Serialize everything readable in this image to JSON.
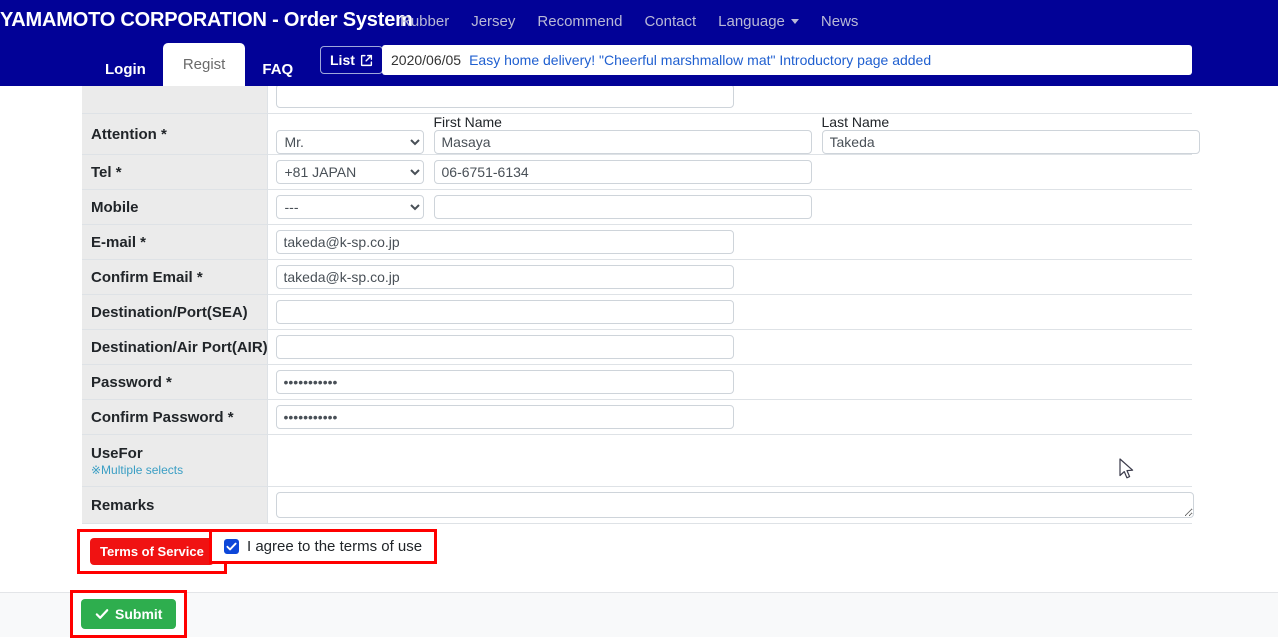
{
  "navbar": {
    "brand": "YAMAMOTO CORPORATION - Order System",
    "links": [
      {
        "label": "Rubber",
        "dropdown": false
      },
      {
        "label": "Jersey",
        "dropdown": false
      },
      {
        "label": "Recommend",
        "dropdown": false
      },
      {
        "label": "Contact",
        "dropdown": false
      },
      {
        "label": "Language",
        "dropdown": true
      },
      {
        "label": "News",
        "dropdown": false
      }
    ],
    "tabs": [
      {
        "label": "Login",
        "active": false
      },
      {
        "label": "Regist",
        "active": true
      },
      {
        "label": "FAQ",
        "active": false
      }
    ],
    "list_button": {
      "label": "List",
      "icon": "external-link-icon"
    },
    "news": {
      "date": "2020/06/05",
      "headline": "Easy home delivery! \"Cheerful marshmallow mat\" Introductory page added"
    },
    "bg_color": "#020297"
  },
  "form": {
    "attention": {
      "label": "Attention *",
      "title_select_value": "Mr.",
      "first_name_header": "First Name",
      "first_name_value": "Masaya",
      "last_name_header": "Last Name",
      "last_name_value": "Takeda"
    },
    "tel": {
      "label": "Tel *",
      "country_value": "+81 JAPAN",
      "number_value": "06-6751-6134"
    },
    "mobile": {
      "label": "Mobile",
      "country_value": "---",
      "number_value": ""
    },
    "email": {
      "label": "E-mail *",
      "value": "takeda@k-sp.co.jp"
    },
    "confirm_email": {
      "label": "Confirm Email *",
      "value": "takeda@k-sp.co.jp"
    },
    "dest_sea": {
      "label": "Destination/Port(SEA)",
      "value": ""
    },
    "dest_air": {
      "label": "Destination/Air Port(AIR)",
      "value": ""
    },
    "password": {
      "label": "Password *",
      "value": "paSSword123"
    },
    "confirm_password": {
      "label": "Confirm Password *",
      "value": "paSSword123"
    },
    "usefor": {
      "label": "UseFor",
      "note": "※Multiple selects"
    },
    "remarks": {
      "label": "Remarks",
      "value": ""
    }
  },
  "actions": {
    "terms_button": "Terms of Service",
    "agree_label": "I agree to the terms of use",
    "agree_checked": true,
    "submit_button": "Submit",
    "highlight_color": "#ff0000",
    "terms_color": "#f01212",
    "submit_color": "#2eae4e"
  }
}
